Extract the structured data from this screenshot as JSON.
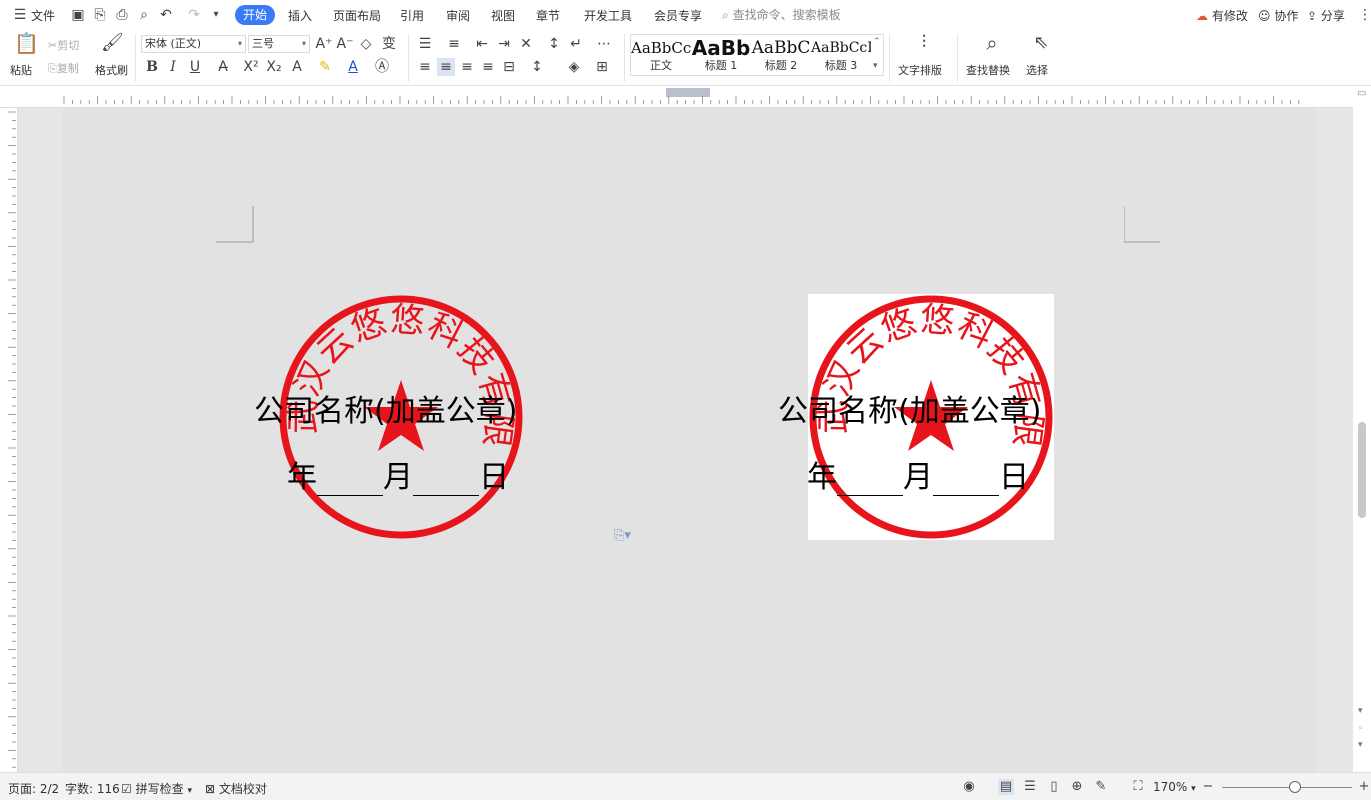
{
  "menubar": {
    "file_label": "文件",
    "tabs": [
      "开始",
      "插入",
      "页面布局",
      "引用",
      "审阅",
      "视图",
      "章节",
      "开发工具",
      "会员专享"
    ],
    "search_placeholder": "查找命令、搜索模板",
    "modified_label": "有修改",
    "collab_label": "协作",
    "share_label": "分享"
  },
  "ribbon": {
    "paste_label": "粘贴",
    "cut_label": "剪切",
    "copy_label": "复制",
    "format_painter_label": "格式刷",
    "font_name": "宋体 (正文)",
    "font_size": "三号",
    "styles": [
      {
        "sample": "AaBbCcDd",
        "name": "正文"
      },
      {
        "sample": "AaBb",
        "name": "标题 1"
      },
      {
        "sample": "AaBbC",
        "name": "标题 2"
      },
      {
        "sample": "AaBbCcI",
        "name": "标题 3"
      }
    ],
    "text_layout_label": "文字排版",
    "find_replace_label": "查找替换",
    "select_label": "选择"
  },
  "document": {
    "stamp_text": "武汉云悠悠科技有限公司",
    "caption_company": "公司名称(加盖公章)",
    "caption_year": "年",
    "caption_month": "月",
    "caption_day": "日"
  },
  "statusbar": {
    "page_info": "页面: 2/2",
    "word_count": "字数: 116",
    "spell_check": "拼写检查",
    "doc_proof": "文档校对",
    "zoom": "170%"
  },
  "colors": {
    "accent": "#3a7bf5",
    "stamp_red": "#e8141b",
    "canvas_gray": "#e2e2e2"
  }
}
